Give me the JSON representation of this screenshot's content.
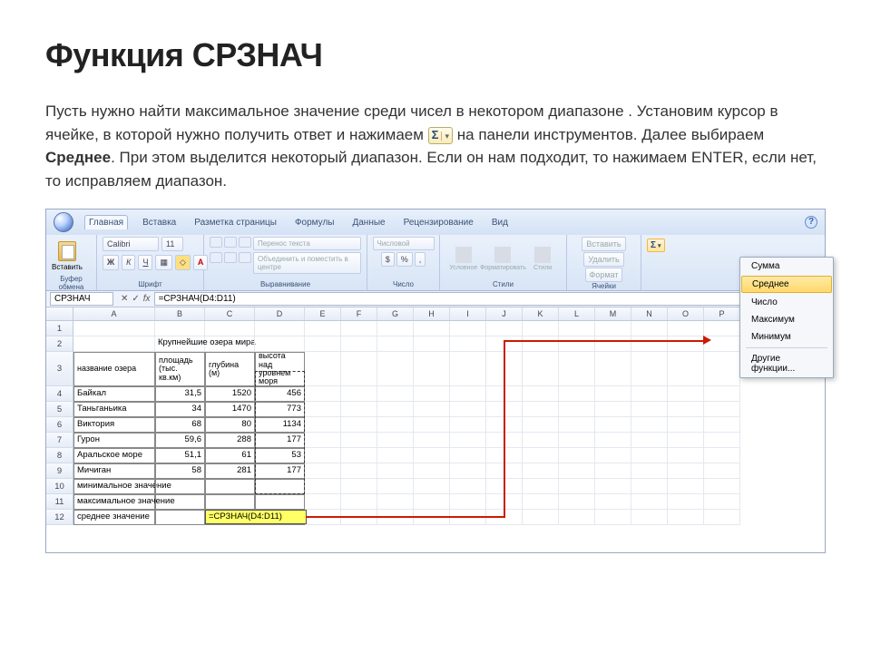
{
  "title": "Функция СРЗНАЧ",
  "description_parts": {
    "p1": "Пусть нужно найти максимальное значение среди чисел в некотором диапазоне . Установим курсор в ячейке, в которой нужно получить ответ  и нажимаем ",
    "p2": "на панели инструментов. Далее выбираем ",
    "bold": "Среднее",
    "p3": ". При этом выделится некоторый диапазон. Если он нам подходит, то  нажимаем ENTER, если нет, то исправляем диапазон."
  },
  "sigma_inline": {
    "sigma": "Σ",
    "ddarrow": "▾"
  },
  "tabs": [
    "Главная",
    "Вставка",
    "Разметка страницы",
    "Формулы",
    "Данные",
    "Рецензирование",
    "Вид"
  ],
  "ribbon": {
    "clipboard": {
      "paste": "Вставить",
      "label": "Буфер обмена"
    },
    "font": {
      "family": "Calibri",
      "size": "11",
      "label": "Шрифт"
    },
    "alignment": {
      "wrap": "Перенос текста",
      "merge": "Объединить и поместить в центре",
      "label": "Выравнивание"
    },
    "number": {
      "format": "Числовой",
      "label": "Число"
    },
    "styles": {
      "cond": "Условное",
      "fmt": "Форматировать",
      "cell": "Стили",
      "label": "Стили"
    },
    "cells": {
      "ins": "Вставить",
      "del": "Удалить",
      "fmt": "Формат",
      "label": "Ячейки"
    },
    "editing": {
      "autosum": "Σ"
    }
  },
  "autosum_menu": [
    "Сумма",
    "Среднее",
    "Число",
    "Максимум",
    "Минимум",
    "Другие функции..."
  ],
  "autosum_selected_index": 1,
  "formula_bar": {
    "name_box": "СРЗНАЧ",
    "formula": "=СРЗНАЧ(D4:D11)"
  },
  "columns": [
    "A",
    "B",
    "C",
    "D",
    "E",
    "F",
    "G",
    "H",
    "I",
    "J",
    "K",
    "L",
    "M",
    "N",
    "O",
    "P"
  ],
  "table": {
    "title": "Крупнейшие озера мира",
    "headers": {
      "a": "название озера",
      "b": "площадь (тыс. кв.км)",
      "c": "глубина (м)",
      "d": "высота над уровнем моря"
    },
    "rows": [
      {
        "a": "Байкал",
        "b": "31,5",
        "c": "1520",
        "d": "456"
      },
      {
        "a": "Таньганьика",
        "b": "34",
        "c": "1470",
        "d": "773"
      },
      {
        "a": "Виктория",
        "b": "68",
        "c": "80",
        "d": "1134"
      },
      {
        "a": "Гурон",
        "b": "59,6",
        "c": "288",
        "d": "177"
      },
      {
        "a": "Аральское море",
        "b": "51,1",
        "c": "61",
        "d": "53"
      },
      {
        "a": "Мичиган",
        "b": "58",
        "c": "281",
        "d": "177"
      }
    ],
    "summary_labels": [
      "минимальное значение",
      "максимальное значение",
      "среднее значение"
    ]
  },
  "active_formula_display": "=СРЗНАЧ(D4:D11)",
  "chart_data": {
    "type": "table",
    "title": "Крупнейшие озера мира",
    "columns": [
      "название озера",
      "площадь (тыс. кв.км)",
      "глубина (м)",
      "высота над уровнем моря"
    ],
    "rows": [
      [
        "Байкал",
        31.5,
        1520,
        456
      ],
      [
        "Таньганьика",
        34,
        1470,
        773
      ],
      [
        "Виктория",
        68,
        80,
        1134
      ],
      [
        "Гурон",
        59.6,
        288,
        177
      ],
      [
        "Аральское море",
        51.1,
        61,
        53
      ],
      [
        "Мичиган",
        58,
        281,
        177
      ]
    ]
  }
}
